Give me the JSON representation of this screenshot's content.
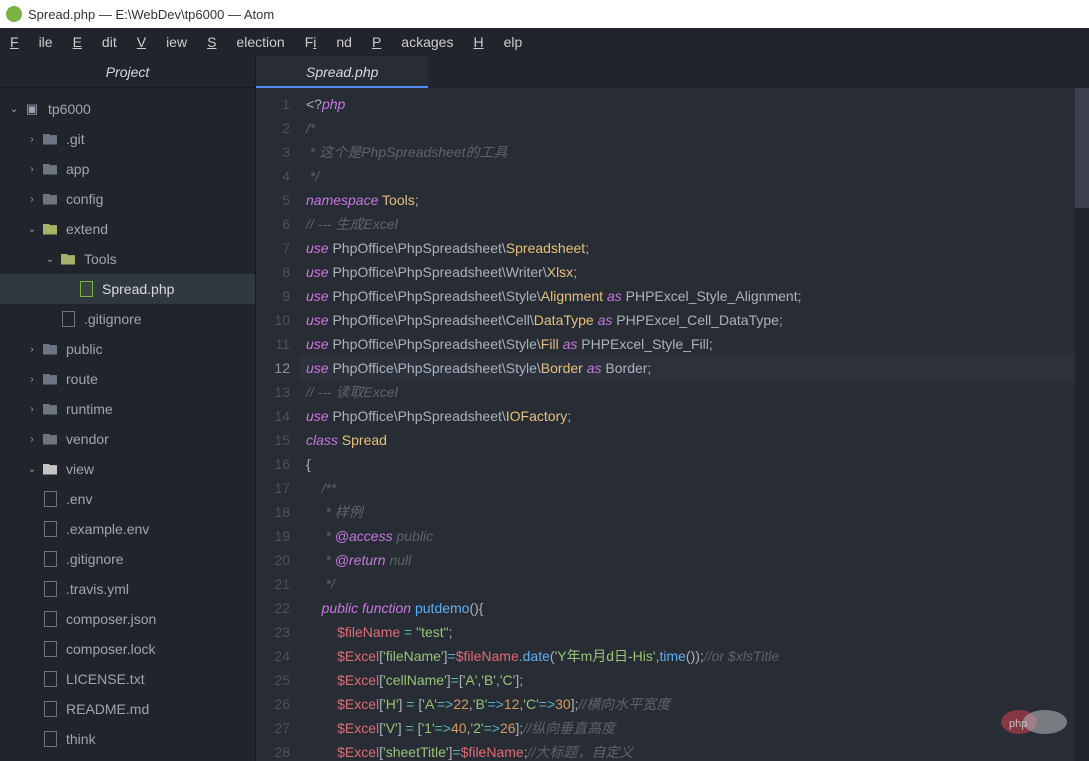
{
  "window": {
    "title": "Spread.php — E:\\WebDev\\tp6000 — Atom"
  },
  "menu": [
    "File",
    "Edit",
    "View",
    "Selection",
    "Find",
    "Packages",
    "Help"
  ],
  "sidebar": {
    "header": "Project",
    "root": "tp6000",
    "items": [
      {
        "name": ".git",
        "indent": 1,
        "type": "folder",
        "twisty": "›"
      },
      {
        "name": "app",
        "indent": 1,
        "type": "folder",
        "twisty": "›"
      },
      {
        "name": "config",
        "indent": 1,
        "type": "folder",
        "twisty": "›"
      },
      {
        "name": "extend",
        "indent": 1,
        "type": "folder-open-y",
        "twisty": "⌄"
      },
      {
        "name": "Tools",
        "indent": 2,
        "type": "folder-open-y",
        "twisty": "⌄"
      },
      {
        "name": "Spread.php",
        "indent": 3,
        "type": "file-g",
        "twisty": "",
        "selected": true
      },
      {
        "name": ".gitignore",
        "indent": 2,
        "type": "file",
        "twisty": ""
      },
      {
        "name": "public",
        "indent": 1,
        "type": "folder",
        "twisty": "›"
      },
      {
        "name": "route",
        "indent": 1,
        "type": "folder",
        "twisty": "›"
      },
      {
        "name": "runtime",
        "indent": 1,
        "type": "folder",
        "twisty": "›"
      },
      {
        "name": "vendor",
        "indent": 1,
        "type": "folder",
        "twisty": "›"
      },
      {
        "name": "view",
        "indent": 1,
        "type": "folder-open",
        "twisty": "⌄"
      },
      {
        "name": ".env",
        "indent": 1,
        "type": "file",
        "twisty": ""
      },
      {
        "name": ".example.env",
        "indent": 1,
        "type": "file",
        "twisty": ""
      },
      {
        "name": ".gitignore",
        "indent": 1,
        "type": "file",
        "twisty": ""
      },
      {
        "name": ".travis.yml",
        "indent": 1,
        "type": "file",
        "twisty": ""
      },
      {
        "name": "composer.json",
        "indent": 1,
        "type": "file",
        "twisty": ""
      },
      {
        "name": "composer.lock",
        "indent": 1,
        "type": "file",
        "twisty": ""
      },
      {
        "name": "LICENSE.txt",
        "indent": 1,
        "type": "file",
        "twisty": ""
      },
      {
        "name": "README.md",
        "indent": 1,
        "type": "file",
        "twisty": ""
      },
      {
        "name": "think",
        "indent": 1,
        "type": "file",
        "twisty": ""
      }
    ]
  },
  "tabs": [
    {
      "label": "Spread.php"
    }
  ],
  "code": {
    "start": 1,
    "highlight": 12,
    "lines": [
      "<span class='pl'>&lt;?</span><span class='kw'>php</span>",
      "<span class='cm'>/*</span>",
      "<span class='cm'> * 这个是PhpSpreadsheet的工具</span>",
      "<span class='cm'> */</span>",
      "<span class='kw'>namespace</span> <span class='cl'>Tools</span><span class='pl'>;</span>",
      "<span class='cm'>// --- 生成Excel</span>",
      "<span class='kw'>use</span> <span class='pl'>PhpOffice\\PhpSpreadsheet\\</span><span class='cl'>Spreadsheet</span><span class='pl'>;</span>",
      "<span class='kw'>use</span> <span class='pl'>PhpOffice\\PhpSpreadsheet\\Writer\\</span><span class='cl'>Xlsx</span><span class='pl'>;</span>",
      "<span class='kw'>use</span> <span class='pl'>PhpOffice\\PhpSpreadsheet\\Style\\</span><span class='cl'>Alignment</span> <span class='kw'>as</span> <span class='pl'>PHPExcel_Style_Alignment;</span>",
      "<span class='kw'>use</span> <span class='pl'>PhpOffice\\PhpSpreadsheet\\Cell\\</span><span class='cl'>DataType</span> <span class='kw'>as</span> <span class='pl'>PHPExcel_Cell_DataType;</span>",
      "<span class='kw'>use</span> <span class='pl'>PhpOffice\\PhpSpreadsheet\\Style\\</span><span class='cl'>Fill</span> <span class='kw'>as</span> <span class='pl'>PHPExcel_Style_Fill;</span>",
      "<span class='kw'>use</span> <span class='pl'>PhpOffice\\PhpSpreadsheet\\Style\\</span><span class='cl'>Border</span> <span class='kw'>as</span> <span class='pl'>Border;</span>",
      "<span class='cm'>// --- 读取Excel</span>",
      "<span class='kw'>use</span> <span class='pl'>PhpOffice\\PhpSpreadsheet\\</span><span class='cl'>IOFactory</span><span class='pl'>;</span>",
      "<span class='kw'>class</span> <span class='cl'>Spread</span>",
      "<span class='pl'>{</span>",
      "    <span class='cm'>/**</span>",
      "<span class='cm'>     * 样例</span>",
      "<span class='cm'>     * <span class='dt'>@access</span> public</span>",
      "<span class='cm'>     * <span class='dt'>@return</span> null</span>",
      "<span class='cm'>     */</span>",
      "    <span class='kw'>public</span> <span class='kw'>function</span> <span class='fn'>putdemo</span><span class='pl'>(){</span>",
      "        <span class='va'>$fileName</span> <span class='op'>=</span> <span class='st'>\"test\"</span><span class='pl'>;</span>",
      "        <span class='va'>$Excel</span><span class='pl'>[</span><span class='st'>'fileName'</span><span class='pl'>]</span><span class='op'>=</span><span class='va'>$fileName</span><span class='op'>.</span><span class='fn'>date</span><span class='pl'>(</span><span class='st'>'Y年m月d日-His'</span><span class='pl'>,</span><span class='fn'>time</span><span class='pl'>());</span><span class='cm'>//or $xlsTitle</span>",
      "        <span class='va'>$Excel</span><span class='pl'>[</span><span class='st'>'cellName'</span><span class='pl'>]</span><span class='op'>=</span><span class='pl'>[</span><span class='st'>'A'</span><span class='pl'>,</span><span class='st'>'B'</span><span class='pl'>,</span><span class='st'>'C'</span><span class='pl'>];</span>",
      "        <span class='va'>$Excel</span><span class='pl'>[</span><span class='st'>'H'</span><span class='pl'>]</span> <span class='op'>=</span> <span class='pl'>[</span><span class='st'>'A'</span><span class='op'>=&gt;</span><span class='nu'>22</span><span class='pl'>,</span><span class='st'>'B'</span><span class='op'>=&gt;</span><span class='nu'>12</span><span class='pl'>,</span><span class='st'>'C'</span><span class='op'>=&gt;</span><span class='nu'>30</span><span class='pl'>];</span><span class='cm'>//横向水平宽度</span>",
      "        <span class='va'>$Excel</span><span class='pl'>[</span><span class='st'>'V'</span><span class='pl'>]</span> <span class='op'>=</span> <span class='pl'>[</span><span class='st'>'1'</span><span class='op'>=&gt;</span><span class='nu'>40</span><span class='pl'>,</span><span class='st'>'2'</span><span class='op'>=&gt;</span><span class='nu'>26</span><span class='pl'>];</span><span class='cm'>//纵向垂直高度</span>",
      "        <span class='va'>$Excel</span><span class='pl'>[</span><span class='st'>'sheetTitle'</span><span class='pl'>]</span><span class='op'>=</span><span class='va'>$fileName</span><span class='pl'>;</span><span class='cm'>//大标题，自定义</span>"
    ]
  }
}
